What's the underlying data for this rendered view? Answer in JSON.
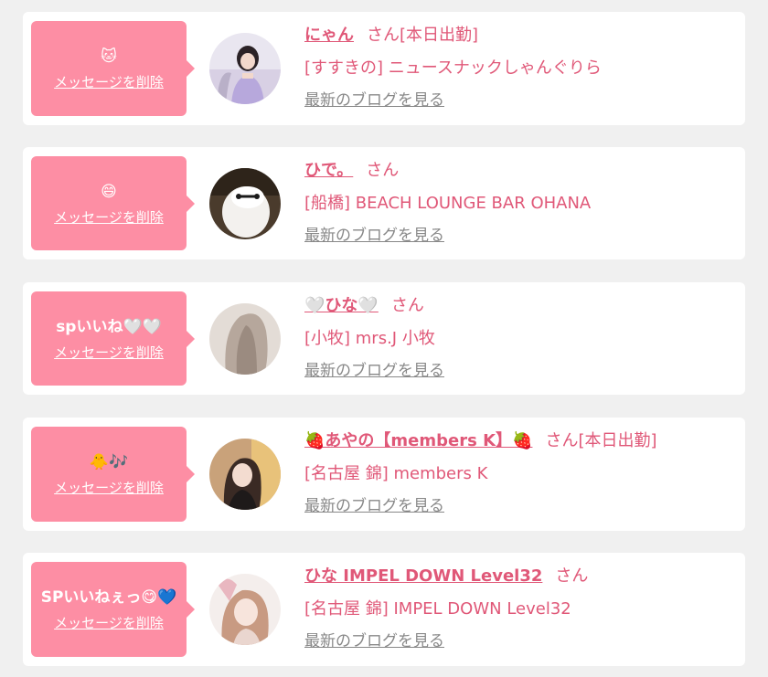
{
  "common": {
    "delete_label": "メッセージを削除",
    "blog_label": "最新のブログを見る",
    "honorific": "さん",
    "accent_color": "#e05878",
    "bubble_color": "#fd8ea4"
  },
  "items": [
    {
      "message": "🐱",
      "name": "にゃん",
      "status": "[本日出勤]",
      "shop": "[すすきの] ニュースナックしゃんぐりら"
    },
    {
      "message": "😄",
      "name": "ひで。",
      "status": "",
      "shop": "[船橋] BEACH LOUNGE BAR OHANA"
    },
    {
      "message": "spいいね🤍🤍",
      "name": "🤍ひな🤍",
      "status": "",
      "shop": "[小牧] mrs.J 小牧"
    },
    {
      "message": "🐥🎶",
      "name": "🍓あやの【members K】🍓",
      "status": "[本日出勤]",
      "shop": "[名古屋 錦] members K"
    },
    {
      "message": "SPいいねぇっ😋💙",
      "name": "ひな IMPEL DOWN Level32",
      "status": "",
      "shop": "[名古屋 錦] IMPEL DOWN Level32"
    }
  ]
}
